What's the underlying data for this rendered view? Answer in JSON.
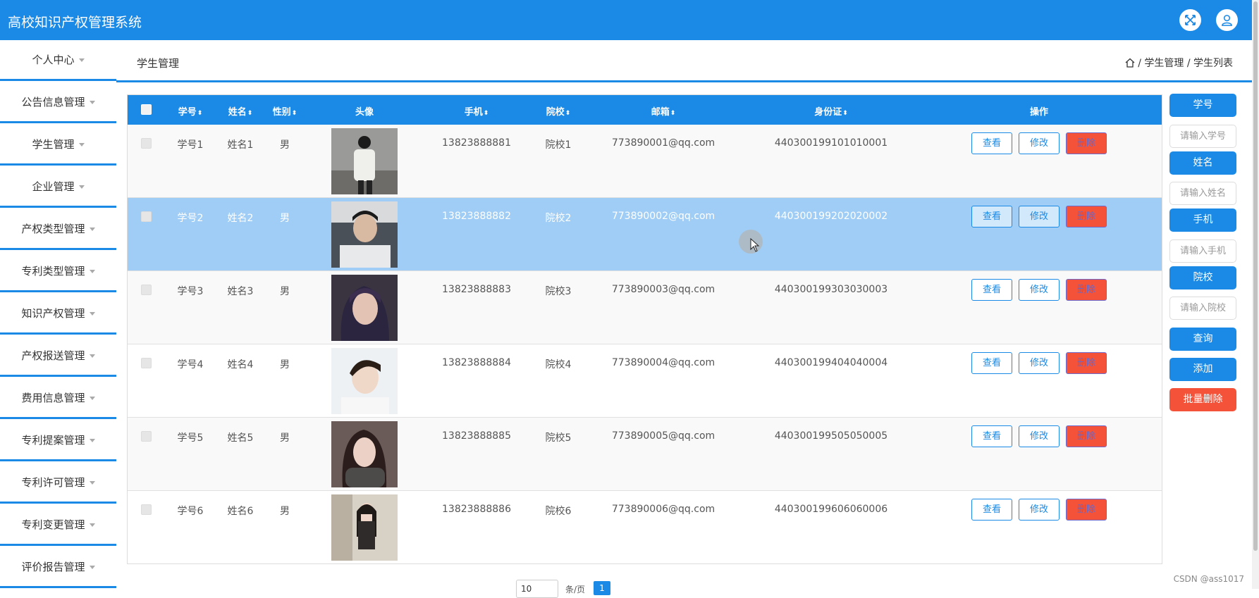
{
  "app": {
    "title": "高校知识产权管理系统"
  },
  "sidebar": {
    "items": [
      {
        "label": "个人中心"
      },
      {
        "label": "公告信息管理"
      },
      {
        "label": "学生管理"
      },
      {
        "label": "企业管理"
      },
      {
        "label": "产权类型管理"
      },
      {
        "label": "专利类型管理"
      },
      {
        "label": "知识产权管理"
      },
      {
        "label": "产权报送管理"
      },
      {
        "label": "费用信息管理"
      },
      {
        "label": "专利提案管理"
      },
      {
        "label": "专利许可管理"
      },
      {
        "label": "专利变更管理"
      },
      {
        "label": "评价报告管理"
      }
    ]
  },
  "page": {
    "title": "学生管理",
    "breadcrumb": [
      "学生管理",
      "学生列表"
    ],
    "breadcrumb_sep": "/"
  },
  "table": {
    "headers": {
      "id": "学号",
      "name": "姓名",
      "gender": "性别",
      "avatar": "头像",
      "phone": "手机",
      "school": "院校",
      "email": "邮箱",
      "idcard": "身份证",
      "actions": "操作"
    },
    "sort_glyph": "⬍",
    "rows": [
      {
        "id": "学号1",
        "name": "姓名1",
        "gender": "男",
        "phone": "13823888881",
        "school": "院校1",
        "email": "773890001@qq.com",
        "idcard": "440300199101010001"
      },
      {
        "id": "学号2",
        "name": "姓名2",
        "gender": "男",
        "phone": "13823888882",
        "school": "院校2",
        "email": "773890002@qq.com",
        "idcard": "440300199202020002"
      },
      {
        "id": "学号3",
        "name": "姓名3",
        "gender": "男",
        "phone": "13823888883",
        "school": "院校3",
        "email": "773890003@qq.com",
        "idcard": "440300199303030003"
      },
      {
        "id": "学号4",
        "name": "姓名4",
        "gender": "男",
        "phone": "13823888884",
        "school": "院校4",
        "email": "773890004@qq.com",
        "idcard": "440300199404040004"
      },
      {
        "id": "学号5",
        "name": "姓名5",
        "gender": "男",
        "phone": "13823888885",
        "school": "院校5",
        "email": "773890005@qq.com",
        "idcard": "440300199505050005"
      },
      {
        "id": "学号6",
        "name": "姓名6",
        "gender": "男",
        "phone": "13823888886",
        "school": "院校6",
        "email": "773890006@qq.com",
        "idcard": "440300199606060006"
      }
    ],
    "actions": {
      "view": "查看",
      "edit": "修改",
      "delete": "删除"
    }
  },
  "search": {
    "id_label": "学号",
    "id_placeholder": "请输入学号",
    "name_label": "姓名",
    "name_placeholder": "请输入姓名",
    "phone_label": "手机",
    "phone_placeholder": "请输入手机",
    "school_label": "院校",
    "school_placeholder": "请输入院校",
    "query": "查询",
    "add": "添加",
    "batch_delete": "批量删除"
  },
  "pagination": {
    "page_size": "10",
    "per_page_label": "条/页",
    "current_page": "1"
  },
  "watermark": "CSDN @ass1017",
  "colors": {
    "primary": "#1a8ae6",
    "danger": "#f4533a",
    "highlight_row": "#9fcdf5"
  }
}
